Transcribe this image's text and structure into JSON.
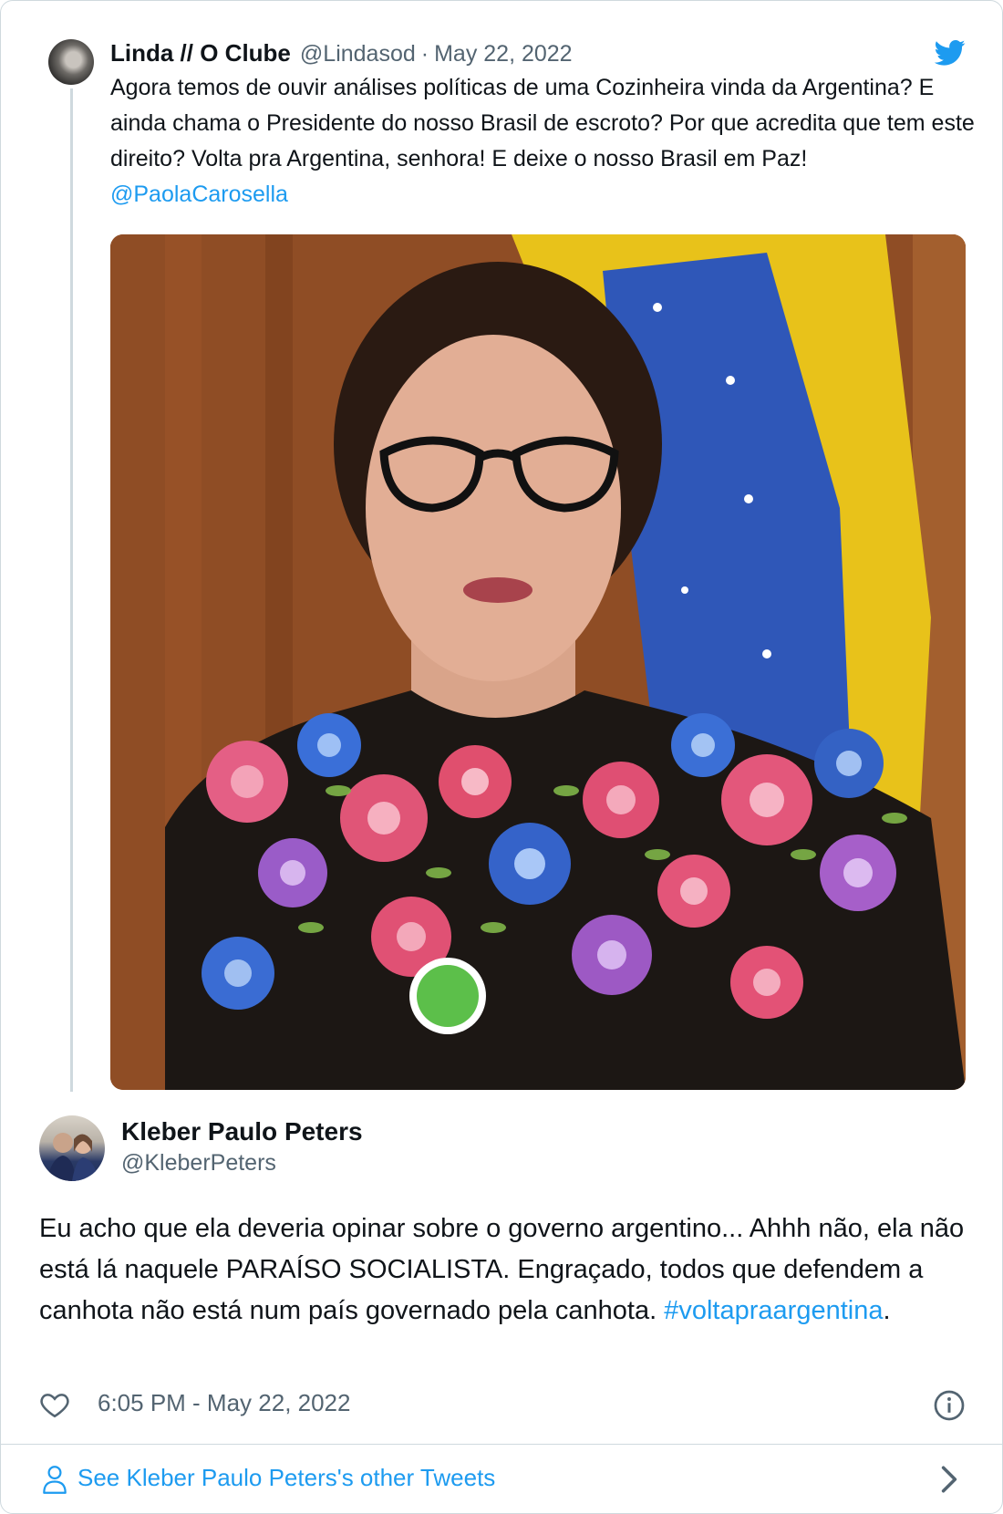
{
  "parent_tweet": {
    "author_name": "Linda // O Clube",
    "handle": "@Lindasod",
    "separator": "·",
    "date": "May 22, 2022",
    "text_before_mention": "Agora temos de ouvir análises políticas de uma Cozinheira vinda da Argentina? E ainda chama o Presidente do nosso Brasil de escroto? Por que acredita que tem este direito? Volta pra Argentina, senhora! E deixe o nosso Brasil em Paz!",
    "mention": "@PaolaCarosella",
    "icon": "twitter-bird-icon"
  },
  "reply_tweet": {
    "author_name": "Kleber Paulo Peters",
    "handle": "@KleberPeters",
    "text_main": "Eu acho que ela deveria opinar sobre o governo argentino... Ahhh não, ela não está lá naquele PARAÍSO SOCIALISTA. Engraçado, todos que defendem a canhota não está num país governado pela canhota.",
    "hashtag": "#voltapraargentina",
    "text_after_hashtag": ".",
    "timestamp": "6:05 PM - May 22, 2022"
  },
  "footer": {
    "link_label": "See Kleber Paulo Peters's other Tweets"
  },
  "colors": {
    "accent_blue": "#1d9bf0",
    "secondary_text": "#536471",
    "border": "#cfd9de"
  }
}
